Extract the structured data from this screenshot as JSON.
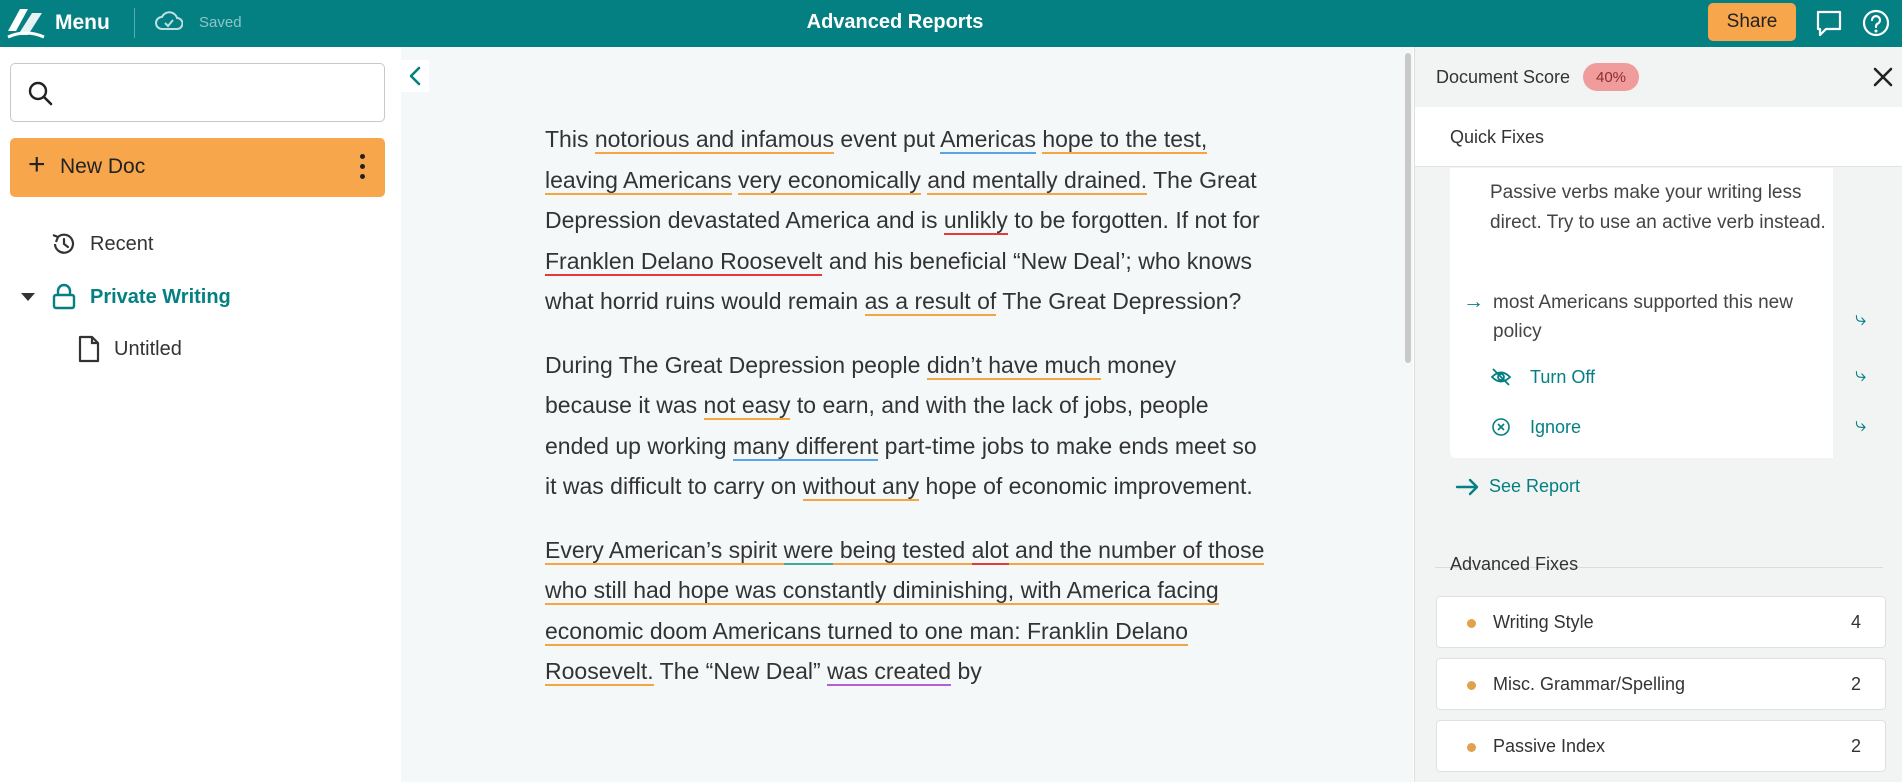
{
  "topbar": {
    "menu_label": "Menu",
    "saved_label": "Saved",
    "title": "Advanced Reports",
    "share_label": "Share",
    "icons": [
      "logo-icon",
      "cloud-saved-icon",
      "chat-icon",
      "help-icon"
    ]
  },
  "sidebar": {
    "search_placeholder": "",
    "new_doc_label": "New Doc",
    "items": [
      {
        "label": "Recent",
        "icon": "history-icon"
      },
      {
        "label": "Private Writing",
        "icon": "lock-icon"
      },
      {
        "label": "Untitled",
        "icon": "document-icon"
      }
    ]
  },
  "document": {
    "paragraphs": [
      [
        {
          "t": "This "
        },
        {
          "t": "notorious and infamous",
          "u": "or"
        },
        {
          "t": " event put "
        },
        {
          "t": "Americas",
          "u": "bl"
        },
        {
          "t": " "
        },
        {
          "t": "hope to the test, leaving Americans",
          "u": "or"
        },
        {
          "t": " "
        },
        {
          "t": "very economically",
          "u": "or"
        },
        {
          "t": " "
        },
        {
          "t": "and mentally drained.",
          "u": "or"
        },
        {
          "t": " The Great Depression devastated America and is "
        },
        {
          "t": "unlikly",
          "u": "rd"
        },
        {
          "t": " to be forgotten. If not for "
        },
        {
          "t": "Franklen Delano Roosevelt",
          "u": "rd"
        },
        {
          "t": " and his beneficial “New Deal’; who knows what horrid ruins would remain "
        },
        {
          "t": "as a result of",
          "u": "or"
        },
        {
          "t": " The Great Depression?"
        }
      ],
      [
        {
          "t": "During The Great Depression people "
        },
        {
          "t": "didn’t have much",
          "u": "or"
        },
        {
          "t": " money because it was "
        },
        {
          "t": "not easy",
          "u": "or"
        },
        {
          "t": " to earn, and with the lack of jobs, people ended up working "
        },
        {
          "t": "many different",
          "u": "bl"
        },
        {
          "t": " part-time jobs to make ends meet so it was difficult to carry on "
        },
        {
          "t": "without any",
          "u": "or"
        },
        {
          "t": " hope of economic improvement."
        }
      ],
      [
        {
          "t": "Every American’s spirit ",
          "u": "or"
        },
        {
          "t": "were",
          "u": "gr"
        },
        {
          "t": " being tested ",
          "u": "or"
        },
        {
          "t": "alot",
          "u": "rd"
        },
        {
          "t": " and the number of those who still had hope was constantly diminishing, with America facing economic doom Americans turned to one man: Franklin Delano Roosevelt.",
          "u": "or"
        },
        {
          "t": " The “New Deal” "
        },
        {
          "t": "was created",
          "u": "pu"
        },
        {
          "t": " by"
        }
      ]
    ]
  },
  "panel": {
    "score_label": "Document Score",
    "score_value": "40%",
    "quick_fixes_label": "Quick Fixes",
    "quick_fix": {
      "description": "Passive verbs make your writing less direct. Try to use an active verb instead.",
      "suggestion": "most Americans supported this new policy",
      "turn_off_label": "Turn Off",
      "ignore_label": "Ignore"
    },
    "see_report_label": "See Report",
    "advanced_fixes_label": "Advanced Fixes",
    "advanced_fixes": [
      {
        "label": "Writing Style",
        "count": "4"
      },
      {
        "label": "Misc. Grammar/Spelling",
        "count": "2"
      },
      {
        "label": "Passive Index",
        "count": "2"
      }
    ]
  },
  "colors": {
    "brand": "#047f82",
    "accent": "#f7a64c",
    "score_badge": "#f09c9c",
    "underline_style": "#f4a640",
    "underline_word_choice": "#5ba4e5",
    "underline_spelling": "#e53a3a",
    "underline_passive": "#b35fd6",
    "underline_grammar": "#47a89a"
  }
}
